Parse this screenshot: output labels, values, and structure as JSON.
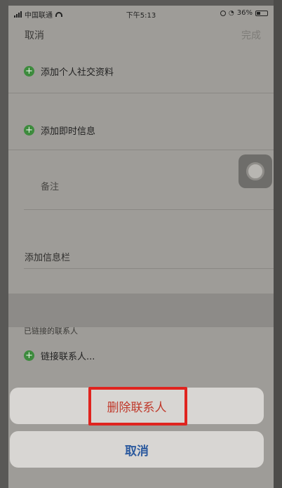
{
  "status_bar": {
    "carrier": "中国联通",
    "time": "下午5:13",
    "battery": "36%"
  },
  "nav": {
    "cancel_label": "取消",
    "done_label": "完成"
  },
  "rows": {
    "add_social": "添加个人社交资料",
    "add_im": "添加即时信息",
    "notes_label": "备注",
    "add_field": "添加信息栏"
  },
  "linked": {
    "header": "已链接的联系人",
    "link_label": "链接联系人..."
  },
  "action_sheet": {
    "delete_label": "删除联系人",
    "cancel_label": "取消"
  },
  "colors": {
    "destructive": "#c0392b",
    "accent": "#2c5a9e",
    "highlight_box": "#e0241f"
  }
}
